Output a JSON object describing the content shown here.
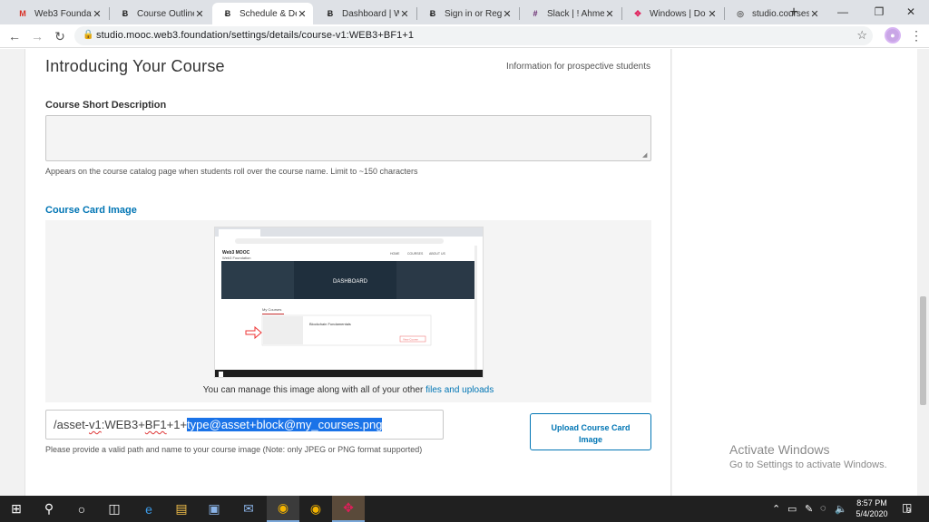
{
  "browser": {
    "tabs": [
      {
        "title": "Web3 Foundati",
        "favicon": "gmail-icon",
        "favicon_text": "M",
        "favicon_color": "#d93025"
      },
      {
        "title": "Course Outline",
        "favicon": "web3-icon",
        "favicon_text": "Ƀ",
        "favicon_color": "#222"
      },
      {
        "title": "Schedule & De",
        "favicon": "web3-icon",
        "favicon_text": "Ƀ",
        "favicon_color": "#222",
        "active": true
      },
      {
        "title": "Dashboard | W",
        "favicon": "web3-icon",
        "favicon_text": "Ƀ",
        "favicon_color": "#222"
      },
      {
        "title": "Sign in or Regi",
        "favicon": "web3-icon",
        "favicon_text": "Ƀ",
        "favicon_color": "#222"
      },
      {
        "title": "Slack | ! Ahmed",
        "favicon": "slack-icon",
        "favicon_text": "#",
        "favicon_color": "#611f69"
      },
      {
        "title": "Windows | Do",
        "favicon": "slack-icon",
        "favicon_text": "✥",
        "favicon_color": "#e01e5a"
      },
      {
        "title": "studio.courses",
        "favicon": "globe-icon",
        "favicon_text": "◎",
        "favicon_color": "#666"
      }
    ],
    "url": "studio.mooc.web3.foundation/settings/details/course-v1:WEB3+BF1+1",
    "new_tab": "+",
    "minimize": "—",
    "restore": "❐",
    "close": "✕"
  },
  "section": {
    "title": "Introducing Your Course",
    "subtitle": "Information for prospective students"
  },
  "short_description": {
    "label": "Course Short Description",
    "value": "",
    "help": "Appears on the course catalog page when students roll over the course name. Limit to ~150 characters"
  },
  "card_image": {
    "label": "Course Card Image",
    "manage_text": "You can manage this image along with all of your other",
    "manage_link": "files and uploads",
    "path_normal": "/asset-",
    "path_squig1": "v1",
    "path_mid": ":WEB3+",
    "path_squig2": "BF1",
    "path_mid2": "+1+",
    "path_selected": "type@asset+block@my_courses.png",
    "path_help": "Please provide a valid path and name to your course image (Note: only JPEG or PNG format supported)",
    "upload_label_1": "Upload Course Card",
    "upload_label_2": "Image"
  },
  "thumb": {
    "brand": "Web3 MOOC",
    "brand_sub": "Web3 Foundation",
    "nav": [
      "HOME",
      "COURSES",
      "ABOUT US"
    ],
    "hero": "DASHBOARD",
    "tab": "My Courses",
    "course": "Blockchain Fundamentals",
    "view_btn": "View Course"
  },
  "watermark": {
    "line1": "Activate Windows",
    "line2": "Go to Settings to activate Windows."
  },
  "taskbar": {
    "time": "8:57 PM",
    "date": "5/4/2020",
    "notifications": "9"
  }
}
